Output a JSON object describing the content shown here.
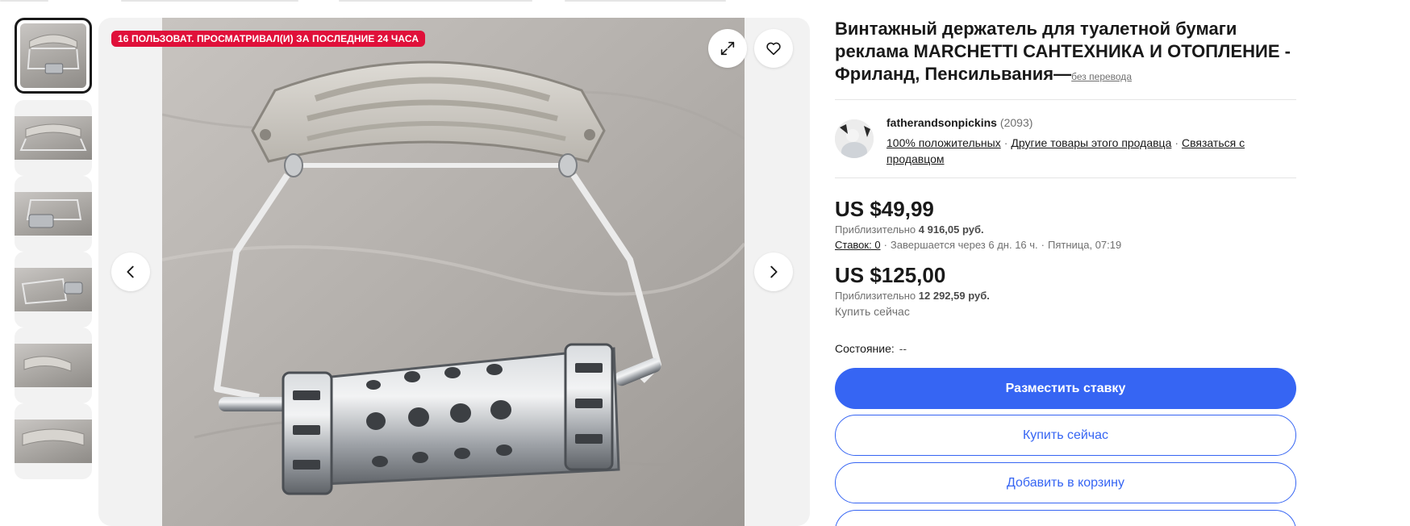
{
  "gallery": {
    "watch_badge": "16 ПОЛЬЗОВАТ. ПРОСМАТРИВАЛ(И) ЗА ПОСЛЕДНИЕ 24 ЧАСА",
    "thumbnail_count": 6,
    "selected_thumbnail": 1
  },
  "listing": {
    "title": "Винтажный держатель для туалетной бумаги реклама MARCHETTI САНТЕХНИКА И ОТОПЛЕНИЕ - Фриланд, Пенсильвания—",
    "no_translation_link": "без перевода"
  },
  "seller": {
    "name": "fatherandsonpickins",
    "feedback_count": "(2093)",
    "positive": "100% положительных",
    "other_items": "Другие товары этого продавца",
    "contact": "Связаться с продавцом"
  },
  "auction": {
    "price": "US $49,99",
    "approx_label": "Приблизительно",
    "approx_value": "4 916,05 руб.",
    "bids_label": "Ставок: 0",
    "ends_in": "Завершается через 6 дн. 16 ч.",
    "end_time": "Пятница, 07:19"
  },
  "buy_now": {
    "price": "US $125,00",
    "approx_label": "Приблизительно",
    "approx_value": "12 292,59 руб.",
    "label": "Купить сейчас"
  },
  "condition": {
    "label": "Состояние:",
    "value": "--"
  },
  "actions": {
    "place_bid": "Разместить ставку",
    "buy_now": "Купить сейчас",
    "add_to_cart": "Добавить в корзину"
  },
  "colors": {
    "accent": "#3665f3",
    "badge": "#e0103a",
    "text": "#191919",
    "muted": "#707070"
  },
  "icons": {
    "expand": "expand-icon",
    "favorite": "heart-icon",
    "prev": "chevron-left-icon",
    "next": "chevron-right-icon"
  }
}
